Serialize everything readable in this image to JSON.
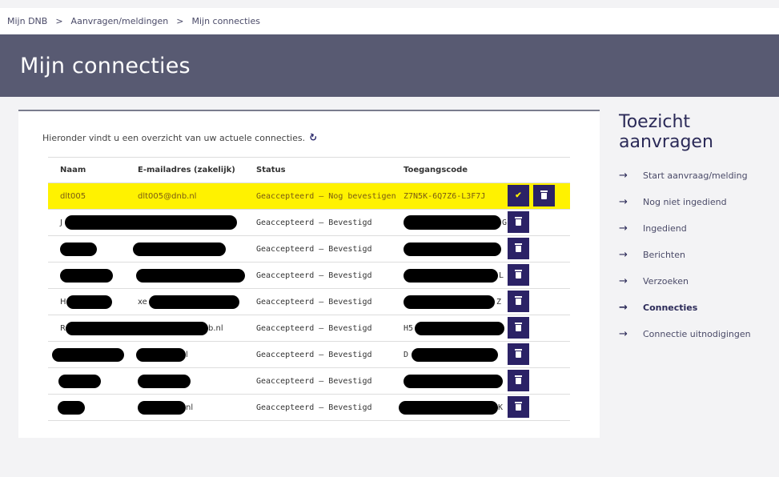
{
  "breadcrumb": {
    "items": [
      "Mijn DNB",
      "Aanvragen/meldingen",
      "Mijn connecties"
    ],
    "separator": ">"
  },
  "page": {
    "title": "Mijn connecties"
  },
  "intro": {
    "text": "Hieronder vindt u een overzicht van uw actuele connecties.",
    "refresh_icon": "refresh-icon"
  },
  "table": {
    "columns": [
      "Naam",
      "E-mailadres (zakelijk)",
      "Status",
      "Toegangscode"
    ],
    "rows": [
      {
        "name": "dlt005",
        "email": "dlt005@dnb.nl",
        "status": "Geaccepteerd – Nog bevestigen",
        "code": "Z7N5K-6Q7Z6-L3F7J"
      },
      {
        "name": "J",
        "email": "",
        "status": "Geaccepteerd – Bevestigd",
        "code": "G"
      },
      {
        "name": "",
        "email": "",
        "status": "Geaccepteerd – Bevestigd",
        "code": ""
      },
      {
        "name": "",
        "email": "",
        "status": "Geaccepteerd – Bevestigd",
        "code": "L"
      },
      {
        "name": "H",
        "email": "xe",
        "status": "Geaccepteerd – Bevestigd",
        "code": "Z"
      },
      {
        "name": "R",
        "email": "b.nl",
        "status": "Geaccepteerd – Bevestigd",
        "code": "H5"
      },
      {
        "name": "",
        "email": "l",
        "status": "Geaccepteerd – Bevestigd",
        "code": "D"
      },
      {
        "name": "",
        "email": "",
        "status": "Geaccepteerd – Bevestigd",
        "code": ""
      },
      {
        "name": "",
        "email": "nl",
        "status": "Geaccepteerd – Bevestigd",
        "code": "K"
      }
    ]
  },
  "sidebar": {
    "title": "Toezicht aanvragen",
    "items": [
      {
        "label": "Start aanvraag/melding",
        "active": false
      },
      {
        "label": "Nog niet ingediend",
        "active": false
      },
      {
        "label": "Ingediend",
        "active": false
      },
      {
        "label": "Berichten",
        "active": false
      },
      {
        "label": "Verzoeken",
        "active": false
      },
      {
        "label": "Connecties",
        "active": true
      },
      {
        "label": "Connectie uitnodigingen",
        "active": false
      }
    ]
  },
  "colors": {
    "banner": "#585a72",
    "highlight": "#fff200",
    "button": "#2b2266",
    "accent": "#2b2a58"
  }
}
